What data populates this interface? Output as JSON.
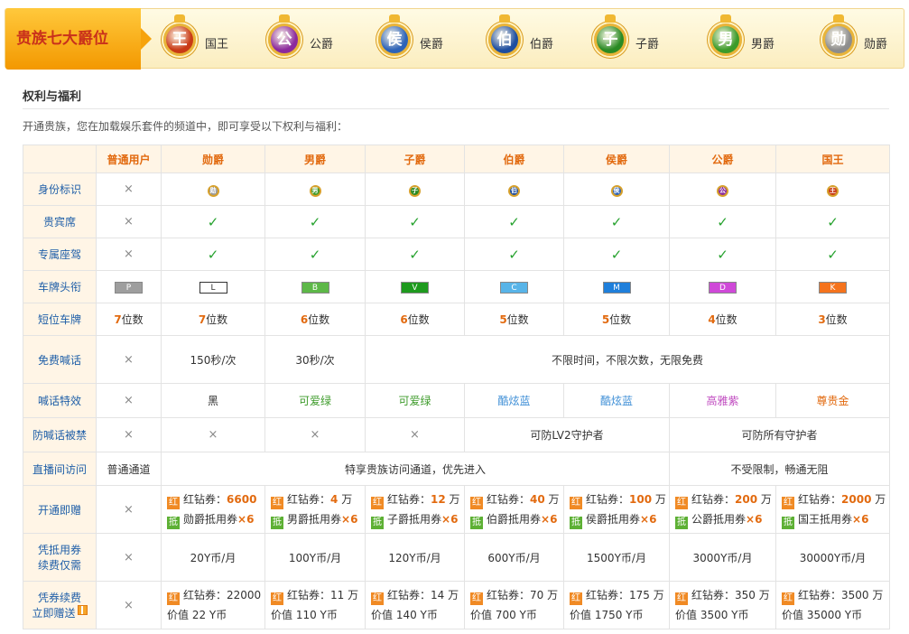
{
  "banner": {
    "title": "贵族七大爵位",
    "ranks": [
      {
        "glyph": "王",
        "name": "国王",
        "color": "#c93a16"
      },
      {
        "glyph": "公",
        "name": "公爵",
        "color": "#8b2a9d"
      },
      {
        "glyph": "侯",
        "name": "侯爵",
        "color": "#2d63b8"
      },
      {
        "glyph": "伯",
        "name": "伯爵",
        "color": "#1e4ea0"
      },
      {
        "glyph": "子",
        "name": "子爵",
        "color": "#2a8a24"
      },
      {
        "glyph": "男",
        "name": "男爵",
        "color": "#3d9b2a"
      },
      {
        "glyph": "勋",
        "name": "勋爵",
        "color": "#8d8d8d"
      }
    ]
  },
  "section": {
    "title": "权利与福利",
    "intro": "开通贵族，您在加载娱乐套件的频道中，即可享受以下权利与福利："
  },
  "table": {
    "corner": "",
    "headers": [
      "普通用户",
      "勋爵",
      "男爵",
      "子爵",
      "伯爵",
      "侯爵",
      "公爵",
      "国王"
    ],
    "marks": {
      "cross": "×",
      "check": "✓"
    },
    "rows": {
      "identity": {
        "label": "身份标识",
        "icons": [
          "勋",
          "男",
          "子",
          "伯",
          "侯",
          "公",
          "王"
        ],
        "icon_colors": [
          "#9a9a9a",
          "#3d9b2a",
          "#2a8a24",
          "#1e4ea0",
          "#2d63b8",
          "#8b2a9d",
          "#c93a16"
        ]
      },
      "vip_seat": {
        "label": "贵宾席"
      },
      "mount": {
        "label": "专属座驾"
      },
      "plate": {
        "label": "车牌头衔",
        "letters": [
          "P",
          "L",
          "B",
          "V",
          "C",
          "M",
          "D",
          "K"
        ],
        "colors": [
          "#9e9e9e",
          "#ffffff",
          "#5db848",
          "#1e9a1e",
          "#58b4e8",
          "#1f7fdb",
          "#cf49d8",
          "#f5731d"
        ]
      },
      "short_plate": {
        "label": "短位车牌",
        "numbers": [
          "7",
          "7",
          "6",
          "6",
          "5",
          "5",
          "4",
          "3"
        ],
        "suffix": "位数"
      },
      "free_shout": {
        "label": "免费喊话",
        "values": [
          "150秒/次",
          "30秒/次"
        ],
        "unlimited": "不限时间，不限次数，无限免费"
      },
      "shout_effect": {
        "label": "喊话特效",
        "values": [
          "黑",
          "可爱绿",
          "可爱绿",
          "酷炫蓝",
          "酷炫蓝",
          "高雅紫",
          "尊贵金"
        ],
        "colors": [
          "#333333",
          "#3d9b2a",
          "#3d9b2a",
          "#3d8ed6",
          "#3d8ed6",
          "#c04bc0",
          "#e26a0f"
        ]
      },
      "anti_ban": {
        "label": "防喊话被禁",
        "lv2": "可防LV2守护者",
        "all": "可防所有守护者"
      },
      "live_access": {
        "label": "直播间访问",
        "normal": "普通通道",
        "priority": "特享贵族访问通道，优先进入",
        "unlimited": "不受限制，畅通无阻"
      },
      "open_gift": {
        "label": "开通即赠",
        "red_tag": "红",
        "green_tag": "抵",
        "red_prefix": "红钻券：",
        "items": [
          {
            "amount": "6600",
            "unit": "",
            "coupon": "勋爵抵用券",
            "count": "×6"
          },
          {
            "amount": "4",
            "unit": " 万",
            "coupon": "男爵抵用券",
            "count": "×6"
          },
          {
            "amount": "12",
            "unit": " 万",
            "coupon": "子爵抵用券",
            "count": "×6"
          },
          {
            "amount": "40",
            "unit": " 万",
            "coupon": "伯爵抵用券",
            "count": "×6"
          },
          {
            "amount": "100",
            "unit": " 万",
            "coupon": "侯爵抵用券",
            "count": "×6"
          },
          {
            "amount": "200",
            "unit": " 万",
            "coupon": "公爵抵用券",
            "count": "×6"
          },
          {
            "amount": "2000",
            "unit": " 万",
            "coupon": "国王抵用券",
            "count": "×6"
          }
        ]
      },
      "renew_price": {
        "label_1": "凭抵用券",
        "label_2": "续费仅需",
        "values": [
          "20Y币/月",
          "100Y币/月",
          "120Y币/月",
          "600Y币/月",
          "1500Y币/月",
          "3000Y币/月",
          "30000Y币/月"
        ]
      },
      "renew_gift": {
        "label_1": "凭券续费",
        "label_2": "立即赠送",
        "items": [
          {
            "red": "红钻券：22000",
            "worth": "价值 22 Y币"
          },
          {
            "red": "红钻券：11 万",
            "worth": "价值 110 Y币"
          },
          {
            "red": "红钻券：14 万",
            "worth": "价值 140 Y币"
          },
          {
            "red": "红钻券：70 万",
            "worth": "价值 700 Y币"
          },
          {
            "red": "红钻券：175 万",
            "worth": "价值 1750 Y币"
          },
          {
            "red": "红钻券：350 万",
            "worth": "价值 3500 Y币"
          },
          {
            "red": "红钻券：3500 万",
            "worth": "价值 35000 Y币"
          }
        ]
      }
    }
  }
}
